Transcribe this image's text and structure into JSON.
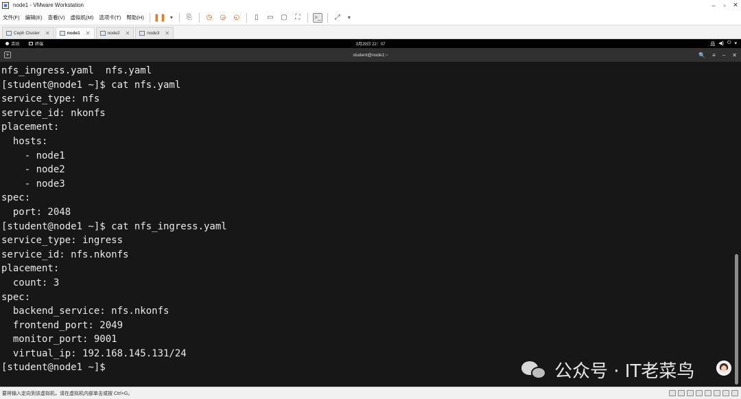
{
  "window": {
    "title": "node1 - VMware Workstation",
    "controls": {
      "minimize": "–",
      "maximize": "▫",
      "close": "✕"
    }
  },
  "menu": {
    "items": [
      "文件(F)",
      "编辑(E)",
      "查看(V)",
      "虚拟机(M)",
      "选项卡(T)",
      "帮助(H)"
    ]
  },
  "toolbar": {
    "pause_icon": "❚❚",
    "dropdown": "▾",
    "send_keys_icon": "⎘",
    "snapshot_icons": [
      "◷",
      "◶",
      "◵"
    ],
    "view_icons": [
      "▯",
      "▭",
      "▢",
      "⛶"
    ],
    "console_icon": ">_",
    "fullscreen_icon": "⤢"
  },
  "tabs": [
    {
      "label": "Ceph Cluster",
      "active": false
    },
    {
      "label": "node1",
      "active": true
    },
    {
      "label": "node2",
      "active": false
    },
    {
      "label": "node3",
      "active": false
    }
  ],
  "tab_close": "✕",
  "gnome": {
    "activities": "活动",
    "app": "终端",
    "clock": "3月29日 22：07",
    "sys_icons": [
      "品",
      "◀)",
      "⏻",
      "▾"
    ]
  },
  "terminal": {
    "new_tab_icon": "+",
    "title": "student@node1:~",
    "controls": [
      "🔍",
      "≡",
      "–",
      "✕"
    ],
    "lines": [
      "nfs_ingress.yaml  nfs.yaml",
      "[student@node1 ~]$ cat nfs.yaml",
      "service_type: nfs",
      "service_id: nkonfs",
      "placement:",
      "  hosts:",
      "    - node1",
      "    - node2",
      "    - node3",
      "spec:",
      "  port: 2048",
      "[student@node1 ~]$ cat nfs_ingress.yaml",
      "service_type: ingress",
      "service_id: nfs.nkonfs",
      "placement:",
      "  count: 3",
      "spec:",
      "  backend_service: nfs.nkonfs",
      "  frontend_port: 2049",
      "  monitor_port: 9001",
      "  virtual_ip: 192.168.145.131/24",
      "[student@node1 ~]$"
    ]
  },
  "watermark": "公众号 · IT老菜鸟",
  "statusbar": {
    "text": "要将输入定向到该虚拟机，请在虚拟机内部单击或按 Ctrl+G。"
  }
}
